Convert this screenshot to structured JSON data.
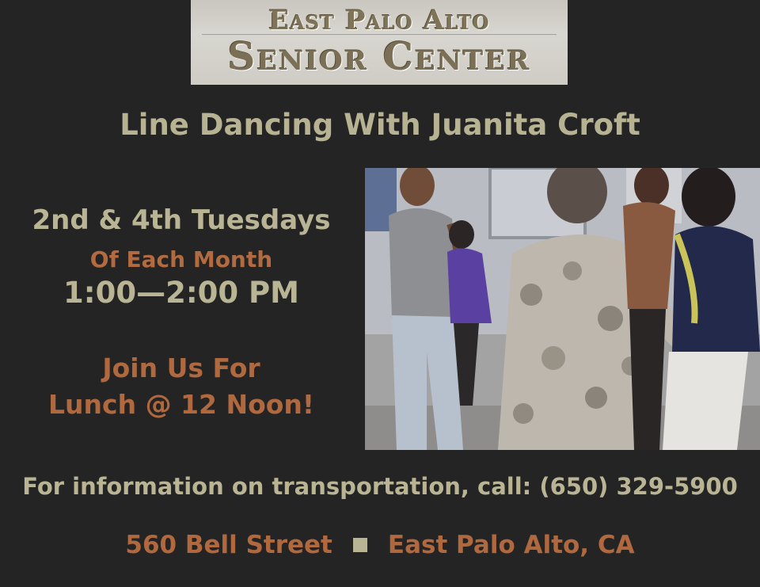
{
  "header": {
    "logo_line1": "East Palo Alto",
    "logo_line2": "Senior Center"
  },
  "event": {
    "title": "Line Dancing With Juanita Croft"
  },
  "schedule": {
    "days": "2nd & 4th Tuesdays",
    "month": "Of Each Month",
    "time": "1:00—2:00 PM"
  },
  "lunch": {
    "line1": "Join Us For",
    "line2": "Lunch @ 12 Noon!"
  },
  "transport": {
    "text": "For information on transportation, call: (650) 329-5900"
  },
  "address": {
    "street": "560 Bell Street",
    "city": "East Palo Alto, CA"
  },
  "colors": {
    "background": "#242424",
    "tan_text": "#b8b494",
    "rust_text": "#b0693f",
    "logo_plate": "#d2cfc8"
  }
}
